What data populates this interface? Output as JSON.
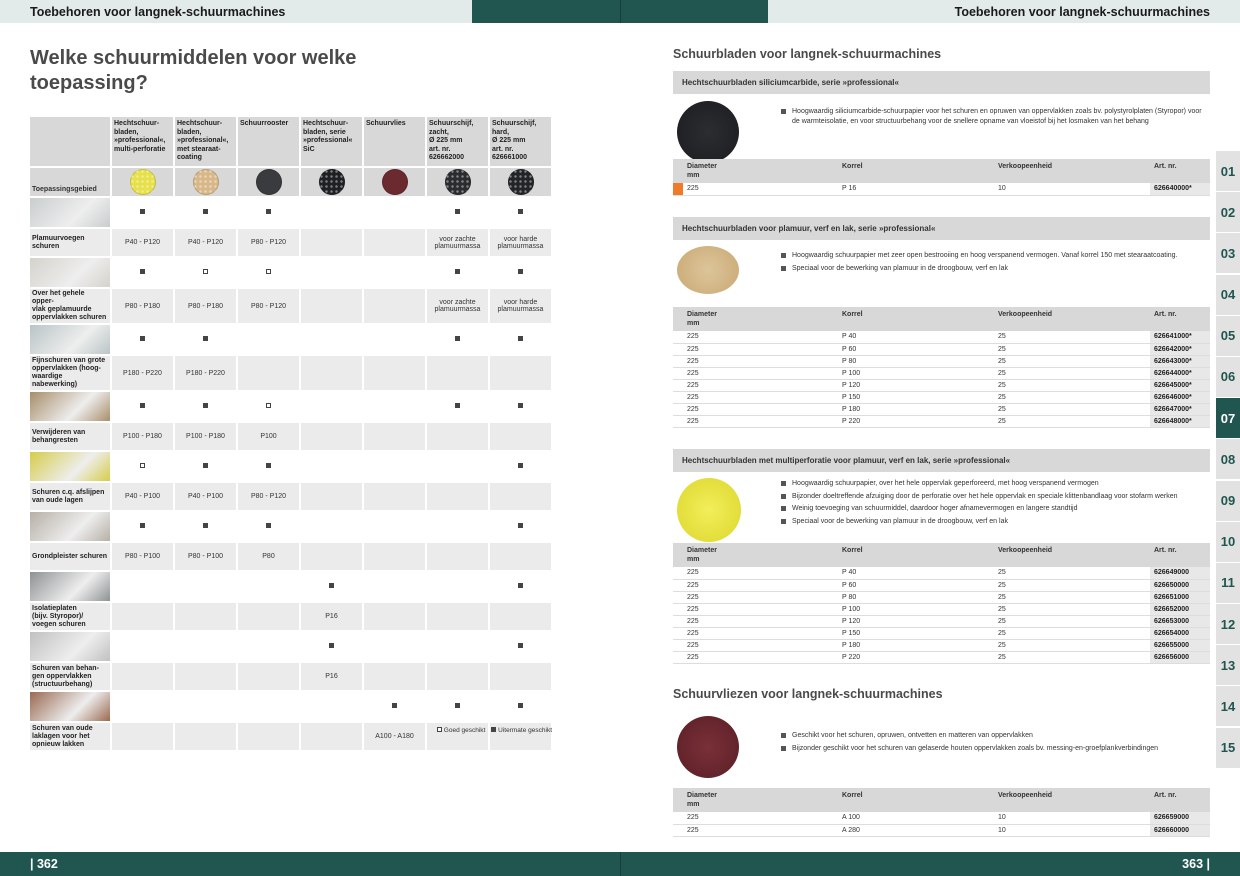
{
  "header": {
    "left_title": "Toebehoren voor langnek-schuurmachines",
    "right_title": "Toebehoren voor langnek-schuurmachines"
  },
  "footer": {
    "left_page": "| 362",
    "right_page": "363 |"
  },
  "left": {
    "title": "Welke schuurmiddelen voor welke toepassing?",
    "corner_label": "Toepassingsgebied",
    "columns": [
      {
        "label": "Hechtschuur-\nbladen,\n»professional«,\nmulti-perforatie",
        "color": "#e6e04a"
      },
      {
        "label": "Hechtschuur-\nbladen,\n»professional«,\nmet stearaat-\ncoating",
        "color": "#d8b888"
      },
      {
        "label": "Schuurrooster",
        "color": "#3a3b3e"
      },
      {
        "label": "Hechtschuur-\nbladen, serie\n»professional«\nSiC",
        "color": "#1f2024"
      },
      {
        "label": "Schuurvlies",
        "color": "#6b2a30"
      },
      {
        "label": "Schuurschijf,\nzacht,\nØ 225 mm\nart. nr.\n626662000",
        "color": "#2b2c30"
      },
      {
        "label": "Schuurschijf,\nhard,\nØ 225 mm\nart. nr.\n626661000",
        "color": "#232428"
      }
    ],
    "rows": [
      {
        "label": "Plamuurvoegen\nschuren",
        "img": "#c9cdce",
        "marks": [
          "f",
          "f",
          "f",
          "",
          "",
          "f",
          "f"
        ],
        "vals": [
          "P40 - P120",
          "P40 - P120",
          "P80 - P120",
          "",
          "",
          "voor zachte\nplamuurmassa",
          "voor harde\nplamuurmassa"
        ]
      },
      {
        "label": "Over het gehele opper-\nvlak geplamuurde\noppervlakken schuren",
        "img": "#d4d2cc",
        "marks": [
          "f",
          "o",
          "o",
          "",
          "",
          "f",
          "f"
        ],
        "vals": [
          "P80 - P180",
          "P80 - P180",
          "P80 - P120",
          "",
          "",
          "voor zachte\nplamuurmassa",
          "voor harde\nplamuurmassa"
        ]
      },
      {
        "label": "Fijnschuren van grote\noppervlakken (hoog-\nwaardige nabewerking)",
        "img": "#b9c4c6",
        "marks": [
          "f",
          "f",
          "",
          "",
          "",
          "f",
          "f"
        ],
        "vals": [
          "P180 - P220",
          "P180 - P220",
          "",
          "",
          "",
          "",
          ""
        ]
      },
      {
        "label": "Verwijderen van\nbehangresten",
        "img": "#a88e6a",
        "marks": [
          "f",
          "f",
          "o",
          "",
          "",
          "f",
          "f"
        ],
        "vals": [
          "P100 - P180",
          "P100 - P180",
          "P100",
          "",
          "",
          "",
          ""
        ]
      },
      {
        "label": "Schuren c.q. afslijpen\nvan oude lagen",
        "img": "#d6cc4a",
        "marks": [
          "o",
          "f",
          "f",
          "",
          "",
          "",
          "f"
        ],
        "vals": [
          "P40 - P100",
          "P40 - P100",
          "P80 - P120",
          "",
          "",
          "",
          ""
        ]
      },
      {
        "label": "Grondpleister schuren",
        "img": "#b6b0a6",
        "marks": [
          "f",
          "f",
          "f",
          "",
          "",
          "",
          "f"
        ],
        "vals": [
          "P80 - P100",
          "P80 - P100",
          "P80",
          "",
          "",
          "",
          ""
        ]
      },
      {
        "label": "Isolatieplaten\n(bijv. Styropor)/\nvoegen schuren",
        "img": "#8e9294",
        "marks": [
          "",
          "",
          "",
          "f",
          "",
          "",
          "f"
        ],
        "vals": [
          "",
          "",
          "",
          "P16",
          "",
          "",
          ""
        ]
      },
      {
        "label": "Schuren van behan-\ngen oppervlakken\n(structuurbehang)",
        "img": "#bfc1bf",
        "marks": [
          "",
          "",
          "",
          "f",
          "",
          "",
          "f"
        ],
        "vals": [
          "",
          "",
          "",
          "P16",
          "",
          "",
          ""
        ]
      },
      {
        "label": "Schuren van oude\nlaklagen voor het\nopnieuw lakken",
        "img": "#9a6a52",
        "marks": [
          "",
          "",
          "",
          "",
          "f",
          "f",
          "f"
        ],
        "vals": [
          "",
          "",
          "",
          "",
          "A100 - A180",
          "",
          ""
        ]
      }
    ],
    "legend": {
      "open": "Goed geschikt",
      "filled": "Uitermate geschikt"
    }
  },
  "right": {
    "title": "Schuurbladen voor langnek-schuurmachines",
    "spec_headers": {
      "diam": "Diameter\nmm",
      "korrel": "Korrel",
      "verk": "Verkoopeenheid",
      "art": "Art. nr."
    },
    "section1": {
      "head": "Hechtschuurbladen siliciumcarbide, serie »professional«",
      "bullets": [
        "Hoogwaardig siliciumcarbide-schuurpapier voor het schuren en opruwen van oppervlakken zoals bv. polystyrolplaten (Styropor) voor de warmteisolatie, en voor structuurbehang voor de snellere opname van vloeistof bij het losmaken van het behang"
      ],
      "rows": [
        [
          "225",
          "P 16",
          "10",
          "626640000*"
        ]
      ]
    },
    "section2": {
      "head": "Hechtschuurbladen voor plamuur, verf en lak, serie »professional«",
      "bullets": [
        "Hoogwaardig schuurpapier met zeer open bestrooiing en hoog verspanend vermogen. Vanaf korrel 150 met stearaatcoating.",
        "Speciaal voor de bewerking van plamuur in de droogbouw, verf en lak"
      ],
      "rows": [
        [
          "225",
          "P 40",
          "25",
          "626641000*"
        ],
        [
          "225",
          "P 60",
          "25",
          "626642000*"
        ],
        [
          "225",
          "P 80",
          "25",
          "626643000*"
        ],
        [
          "225",
          "P 100",
          "25",
          "626644000*"
        ],
        [
          "225",
          "P 120",
          "25",
          "626645000*"
        ],
        [
          "225",
          "P 150",
          "25",
          "626646000*"
        ],
        [
          "225",
          "P 180",
          "25",
          "626647000*"
        ],
        [
          "225",
          "P 220",
          "25",
          "626648000*"
        ]
      ]
    },
    "section3": {
      "head": "Hechtschuurbladen met multiperforatie voor plamuur, verf en lak, serie »professional«",
      "bullets": [
        "Hoogwaardig schuurpapier, over het hele oppervlak geperforeerd, met hoog verspanend vermogen",
        "Bijzonder doeltreffende afzuiging door de perforatie over het hele oppervlak en speciale klittenbandlaag voor stofarm werken",
        "Weinig toevoeging van schuurmiddel, daardoor hoger afnamevermogen en langere standtijd",
        "Speciaal voor de bewerking van plamuur in de droogbouw, verf en lak"
      ],
      "rows": [
        [
          "225",
          "P 40",
          "25",
          "626649000"
        ],
        [
          "225",
          "P 60",
          "25",
          "626650000"
        ],
        [
          "225",
          "P 80",
          "25",
          "626651000"
        ],
        [
          "225",
          "P 100",
          "25",
          "626652000"
        ],
        [
          "225",
          "P 120",
          "25",
          "626653000"
        ],
        [
          "225",
          "P 150",
          "25",
          "626654000"
        ],
        [
          "225",
          "P 180",
          "25",
          "626655000"
        ],
        [
          "225",
          "P 220",
          "25",
          "626656000"
        ]
      ]
    },
    "section4": {
      "title": "Schuurvliezen voor langnek-schuurmachines",
      "bullets": [
        "Geschikt voor het schuren, opruwen, ontvetten en matteren van oppervlakken",
        "Bijzonder geschikt voor het schuren van gelaserde houten oppervlakken zoals bv. messing-en-groefplankverbindingen"
      ],
      "rows": [
        [
          "225",
          "A 100",
          "10",
          "626659000"
        ],
        [
          "225",
          "A 280",
          "10",
          "626660000"
        ]
      ]
    },
    "tabs": [
      "01",
      "02",
      "03",
      "04",
      "05",
      "06",
      "07",
      "08",
      "09",
      "10",
      "11",
      "12",
      "13",
      "14",
      "15"
    ],
    "active_tab": "07"
  }
}
